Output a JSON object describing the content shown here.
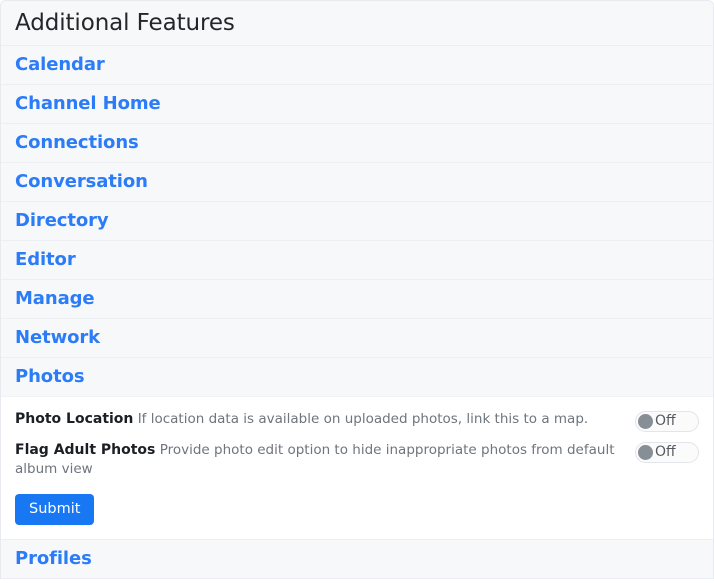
{
  "header": {
    "title": "Additional Features"
  },
  "accordion": {
    "items": [
      {
        "label": "Calendar",
        "expanded": false
      },
      {
        "label": "Channel Home",
        "expanded": false
      },
      {
        "label": "Connections",
        "expanded": false
      },
      {
        "label": "Conversation",
        "expanded": false
      },
      {
        "label": "Directory",
        "expanded": false
      },
      {
        "label": "Editor",
        "expanded": false
      },
      {
        "label": "Manage",
        "expanded": false
      },
      {
        "label": "Network",
        "expanded": false
      },
      {
        "label": "Photos",
        "expanded": true
      },
      {
        "label": "Profiles",
        "expanded": false
      }
    ]
  },
  "photos_panel": {
    "settings": [
      {
        "label": "Photo Location",
        "description": "If location data is available on uploaded photos, link this to a map.",
        "toggle_state": "Off"
      },
      {
        "label": "Flag Adult Photos",
        "description": "Provide photo edit option to hide inappropriate photos from default album view",
        "toggle_state": "Off"
      }
    ],
    "submit_label": "Submit"
  },
  "colors": {
    "link": "#2b7cf6",
    "primary_button": "#1877f2",
    "row_background": "#f7f8fa",
    "toggle_knob": "#868e96"
  }
}
